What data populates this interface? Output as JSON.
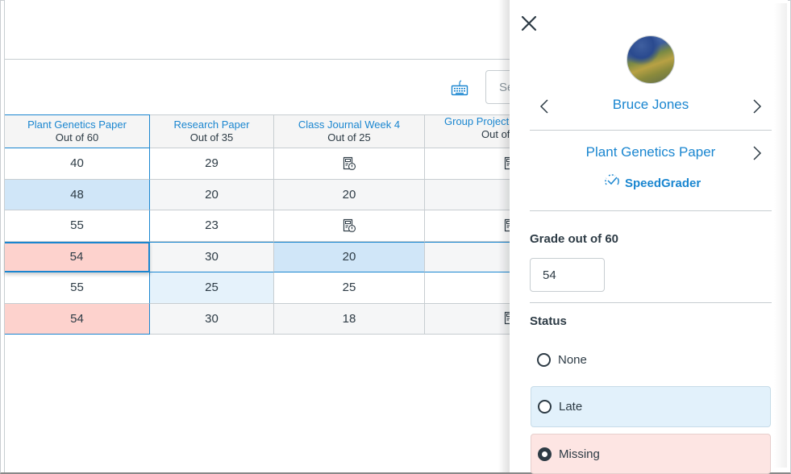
{
  "toolbar": {
    "keyboard_icon": "keyboard-icon",
    "search_placeholder": "Search"
  },
  "grid": {
    "columns": [
      {
        "title": "Plant Genetics Paper",
        "subtitle": "Out of 60"
      },
      {
        "title": "Research Paper",
        "subtitle": "Out of 35"
      },
      {
        "title": "Class Journal Week 4",
        "subtitle": "Out of 25"
      },
      {
        "title": "Group Project",
        "subtitle": "Out of"
      }
    ],
    "rows": [
      {
        "cells": [
          "40",
          "29",
          "",
          ""
        ],
        "icons": [
          null,
          null,
          "submission-icon",
          "submission-icon"
        ],
        "status": [
          null,
          null,
          null,
          null
        ]
      },
      {
        "cells": [
          "48",
          "20",
          "20",
          ""
        ],
        "icons": [
          null,
          null,
          null,
          null
        ],
        "status": [
          "late",
          null,
          null,
          null
        ]
      },
      {
        "cells": [
          "55",
          "23",
          "",
          ""
        ],
        "icons": [
          null,
          null,
          "submission-icon",
          "submission-icon"
        ],
        "status": [
          null,
          null,
          null,
          null
        ]
      },
      {
        "cells": [
          "54",
          "30",
          "20",
          ""
        ],
        "icons": [
          null,
          null,
          null,
          null
        ],
        "status": [
          "missing",
          null,
          "late",
          null
        ]
      },
      {
        "cells": [
          "55",
          "25",
          "25",
          ""
        ],
        "icons": [
          null,
          null,
          null,
          null
        ],
        "status": [
          null,
          "late",
          null,
          null
        ]
      },
      {
        "cells": [
          "54",
          "30",
          "18",
          ""
        ],
        "icons": [
          null,
          null,
          null,
          "submission-icon"
        ],
        "status": [
          "missing",
          null,
          null,
          null
        ]
      }
    ]
  },
  "tray": {
    "close_icon": "close-icon",
    "student_name": "Bruce Jones",
    "assignment_name": "Plant Genetics Paper",
    "speedgrader_label": "SpeedGrader",
    "grade_label": "Grade out of 60",
    "grade_value": "54",
    "status_label": "Status",
    "status_options": [
      {
        "label": "None",
        "checked": false
      },
      {
        "label": "Late",
        "checked": false
      },
      {
        "label": "Missing",
        "checked": true
      }
    ]
  },
  "colors": {
    "accent": "#1a86d0",
    "late_bg": "#d0e6f8",
    "missing_bg": "#fdd2cd",
    "text": "#2d3b45"
  }
}
